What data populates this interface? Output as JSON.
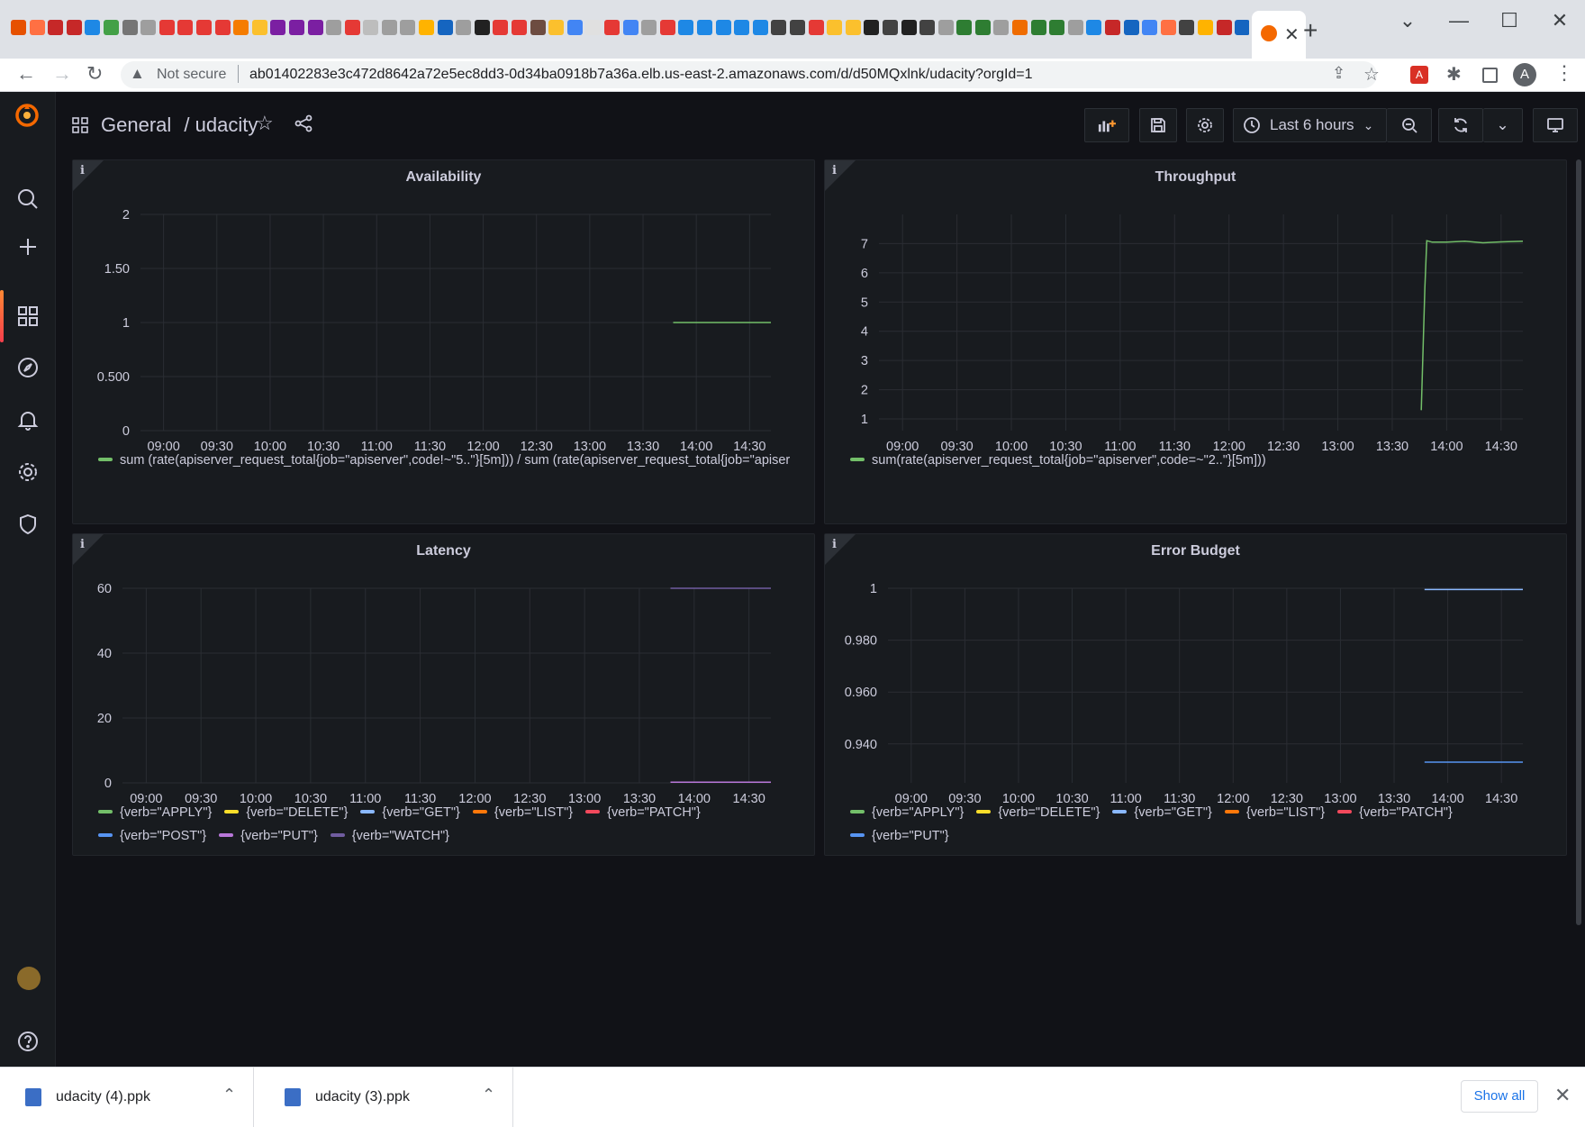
{
  "browser": {
    "tab_close": "✕",
    "new_tab": "+",
    "window": {
      "minimize": "—",
      "maximize": "☐",
      "close": "✕"
    },
    "address": {
      "security_label": "Not secure",
      "url": "ab01402283e3c472d8642a72e5ec8dd3-0d34ba0918b7a36a.elb.us-east-2.amazonaws.com/d/d50MQxlnk/udacity?orgId=1"
    },
    "profile_initial": "A",
    "bookmark_icon_colors": [
      "#e65100",
      "#ff7043",
      "#c62828",
      "#c62828",
      "#1e88e5",
      "#43a047",
      "#757575",
      "#9e9e9e",
      "#e53935",
      "#e53935",
      "#e53935",
      "#e53935",
      "#f57c00",
      "#fbc02d",
      "#7b1fa2",
      "#7b1fa2",
      "#7b1fa2",
      "#9e9e9e",
      "#e53935",
      "#bdbdbd",
      "#9e9e9e",
      "#9e9e9e",
      "#ffb300",
      "#1565c0",
      "#9e9e9e",
      "#212121",
      "#e53935",
      "#e53935",
      "#6d4c41",
      "#fbc02d",
      "#4285f4",
      "#e0e0e0",
      "#e53935",
      "#4285f4",
      "#9e9e9e",
      "#e53935",
      "#1e88e5",
      "#1e88e5",
      "#1e88e5",
      "#1e88e5",
      "#1e88e5",
      "#424242",
      "#424242",
      "#e53935",
      "#fbc02d",
      "#fbc02d",
      "#212121",
      "#424242",
      "#212121",
      "#424242",
      "#9e9e9e",
      "#2e7d32",
      "#2e7d32",
      "#9e9e9e",
      "#ef6c00",
      "#2e7d32",
      "#2e7d32",
      "#9e9e9e",
      "#1e88e5",
      "#c62828",
      "#1565c0",
      "#4285f4",
      "#ff7043",
      "#424242",
      "#ffb300",
      "#c62828",
      "#1565c0",
      "#c62828",
      "#8d6e63"
    ]
  },
  "grafana": {
    "breadcrumb": {
      "folder": "General",
      "separator": "/",
      "dashboard": "udacity"
    },
    "time_picker": "Last 6 hours",
    "panels": [
      {
        "title": "Availability",
        "info_icon": "i",
        "legend": [
          {
            "label": "sum (rate(apiserver_request_total{job=\"apiserver\",code!~\"5..\"}[5m])) / sum (rate(apiserver_request_total{job=\"apiser",
            "color": "#73bf69"
          }
        ]
      },
      {
        "title": "Throughput",
        "info_icon": "i",
        "legend": [
          {
            "label": "sum(rate(apiserver_request_total{job=\"apiserver\",code=~\"2..\"}[5m]))",
            "color": "#73bf69"
          }
        ]
      },
      {
        "title": "Latency",
        "info_icon": "i",
        "legend": [
          {
            "label": "{verb=\"APPLY\"}",
            "color": "#73bf69"
          },
          {
            "label": "{verb=\"DELETE\"}",
            "color": "#fade2a"
          },
          {
            "label": "{verb=\"GET\"}",
            "color": "#8ab8ff"
          },
          {
            "label": "{verb=\"LIST\"}",
            "color": "#ff780a"
          },
          {
            "label": "{verb=\"PATCH\"}",
            "color": "#f2495c"
          },
          {
            "label": "{verb=\"POST\"}",
            "color": "#5794f2"
          },
          {
            "label": "{verb=\"PUT\"}",
            "color": "#b877d9"
          },
          {
            "label": "{verb=\"WATCH\"}",
            "color": "#705da0"
          }
        ]
      },
      {
        "title": "Error Budget",
        "info_icon": "i",
        "legend": [
          {
            "label": "{verb=\"APPLY\"}",
            "color": "#73bf69"
          },
          {
            "label": "{verb=\"DELETE\"}",
            "color": "#fade2a"
          },
          {
            "label": "{verb=\"GET\"}",
            "color": "#8ab8ff"
          },
          {
            "label": "{verb=\"LIST\"}",
            "color": "#ff780a"
          },
          {
            "label": "{verb=\"PATCH\"}",
            "color": "#f2495c"
          },
          {
            "label": "{verb=\"PUT\"}",
            "color": "#5794f2"
          }
        ]
      }
    ]
  },
  "chart_data": [
    {
      "type": "line",
      "title": "Availability",
      "x_ticks": [
        "09:00",
        "09:30",
        "10:00",
        "10:30",
        "11:00",
        "11:30",
        "12:00",
        "12:30",
        "13:00",
        "13:30",
        "14:00",
        "14:30"
      ],
      "y_ticks": [
        "0",
        "0.500",
        "1",
        "1.50",
        "2"
      ],
      "ylim": [
        0,
        2
      ],
      "grid": true,
      "series": [
        {
          "name": "sum (rate(apiserver_request_total{job=\"apiserver\",code!~\"5..\"}[5m])) / sum (rate(apiserver_request_total{job=\"apiser",
          "color": "#73bf69",
          "x": [
            "13:47",
            "14:42"
          ],
          "y": [
            1,
            1
          ]
        }
      ]
    },
    {
      "type": "line",
      "title": "Throughput",
      "x_ticks": [
        "09:00",
        "09:30",
        "10:00",
        "10:30",
        "11:00",
        "11:30",
        "12:00",
        "12:30",
        "13:00",
        "13:30",
        "14:00",
        "14:30"
      ],
      "y_ticks": [
        "1",
        "2",
        "3",
        "4",
        "5",
        "6",
        "7"
      ],
      "ylim": [
        0.6,
        8
      ],
      "grid": true,
      "series": [
        {
          "name": "sum(rate(apiserver_request_total{job=\"apiserver\",code=~\"2..\"}[5m]))",
          "color": "#73bf69",
          "x": [
            "13:46",
            "13:48",
            "13:49",
            "13:52",
            "14:00",
            "14:10",
            "14:20",
            "14:30",
            "14:42"
          ],
          "y": [
            1.3,
            5.5,
            7.1,
            7.05,
            7.05,
            7.08,
            7.03,
            7.06,
            7.08
          ]
        }
      ]
    },
    {
      "type": "line",
      "title": "Latency",
      "x_ticks": [
        "09:00",
        "09:30",
        "10:00",
        "10:30",
        "11:00",
        "11:30",
        "12:00",
        "12:30",
        "13:00",
        "13:30",
        "14:00",
        "14:30"
      ],
      "y_ticks": [
        "0",
        "20",
        "40",
        "60"
      ],
      "ylim": [
        0,
        60
      ],
      "grid": true,
      "series": [
        {
          "name": "{verb=\"WATCH\"}",
          "color": "#705da0",
          "x": [
            "13:47",
            "14:42"
          ],
          "y": [
            60,
            60
          ]
        },
        {
          "name": "{verb=\"PUT\"}",
          "color": "#b877d9",
          "x": [
            "13:47",
            "14:42"
          ],
          "y": [
            0.2,
            0.2
          ]
        }
      ]
    },
    {
      "type": "line",
      "title": "Error Budget",
      "x_ticks": [
        "09:00",
        "09:30",
        "10:00",
        "10:30",
        "11:00",
        "11:30",
        "12:00",
        "12:30",
        "13:00",
        "13:30",
        "14:00",
        "14:30"
      ],
      "y_ticks": [
        "0.940",
        "0.960",
        "0.980",
        "1"
      ],
      "ylim": [
        0.925,
        1
      ],
      "grid": true,
      "series": [
        {
          "name": "{verb=\"GET\"}",
          "color": "#8ab8ff",
          "x": [
            "13:47",
            "14:42"
          ],
          "y": [
            0.9995,
            0.9995
          ]
        },
        {
          "name": "{verb=\"PUT\"}",
          "color": "#5794f2",
          "x": [
            "13:47",
            "14:42"
          ],
          "y": [
            0.933,
            0.933
          ]
        }
      ]
    }
  ],
  "downloads": {
    "items": [
      {
        "name": "udacity (4).ppk"
      },
      {
        "name": "udacity (3).ppk"
      }
    ],
    "show_all": "Show all",
    "close": "✕"
  }
}
